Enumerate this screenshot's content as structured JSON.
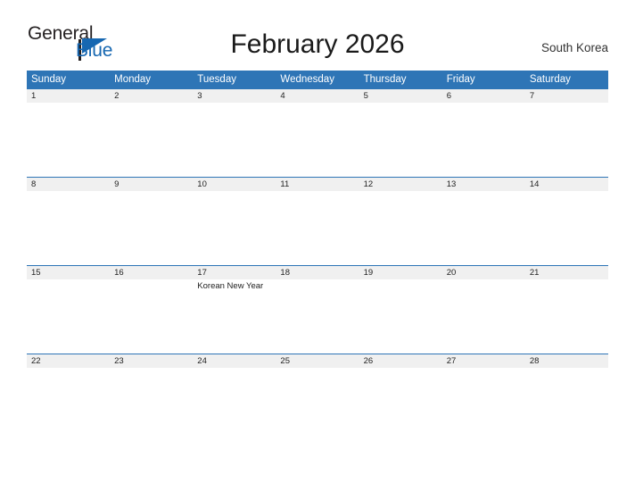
{
  "brand": {
    "word_one": "General",
    "word_two": "Blue",
    "accent_color": "#1667b1",
    "text_color": "#231f20"
  },
  "header": {
    "title": "February 2026",
    "region": "South Korea",
    "header_bg": "#2e75b6",
    "daynum_band_bg": "#f0f0f0"
  },
  "weekdays": [
    "Sunday",
    "Monday",
    "Tuesday",
    "Wednesday",
    "Thursday",
    "Friday",
    "Saturday"
  ],
  "weeks": [
    [
      {
        "day": "1",
        "events": []
      },
      {
        "day": "2",
        "events": []
      },
      {
        "day": "3",
        "events": []
      },
      {
        "day": "4",
        "events": []
      },
      {
        "day": "5",
        "events": []
      },
      {
        "day": "6",
        "events": []
      },
      {
        "day": "7",
        "events": []
      }
    ],
    [
      {
        "day": "8",
        "events": []
      },
      {
        "day": "9",
        "events": []
      },
      {
        "day": "10",
        "events": []
      },
      {
        "day": "11",
        "events": []
      },
      {
        "day": "12",
        "events": []
      },
      {
        "day": "13",
        "events": []
      },
      {
        "day": "14",
        "events": []
      }
    ],
    [
      {
        "day": "15",
        "events": []
      },
      {
        "day": "16",
        "events": []
      },
      {
        "day": "17",
        "events": [
          "Korean New Year"
        ]
      },
      {
        "day": "18",
        "events": []
      },
      {
        "day": "19",
        "events": []
      },
      {
        "day": "20",
        "events": []
      },
      {
        "day": "21",
        "events": []
      }
    ],
    [
      {
        "day": "22",
        "events": []
      },
      {
        "day": "23",
        "events": []
      },
      {
        "day": "24",
        "events": []
      },
      {
        "day": "25",
        "events": []
      },
      {
        "day": "26",
        "events": []
      },
      {
        "day": "27",
        "events": []
      },
      {
        "day": "28",
        "events": []
      }
    ]
  ]
}
